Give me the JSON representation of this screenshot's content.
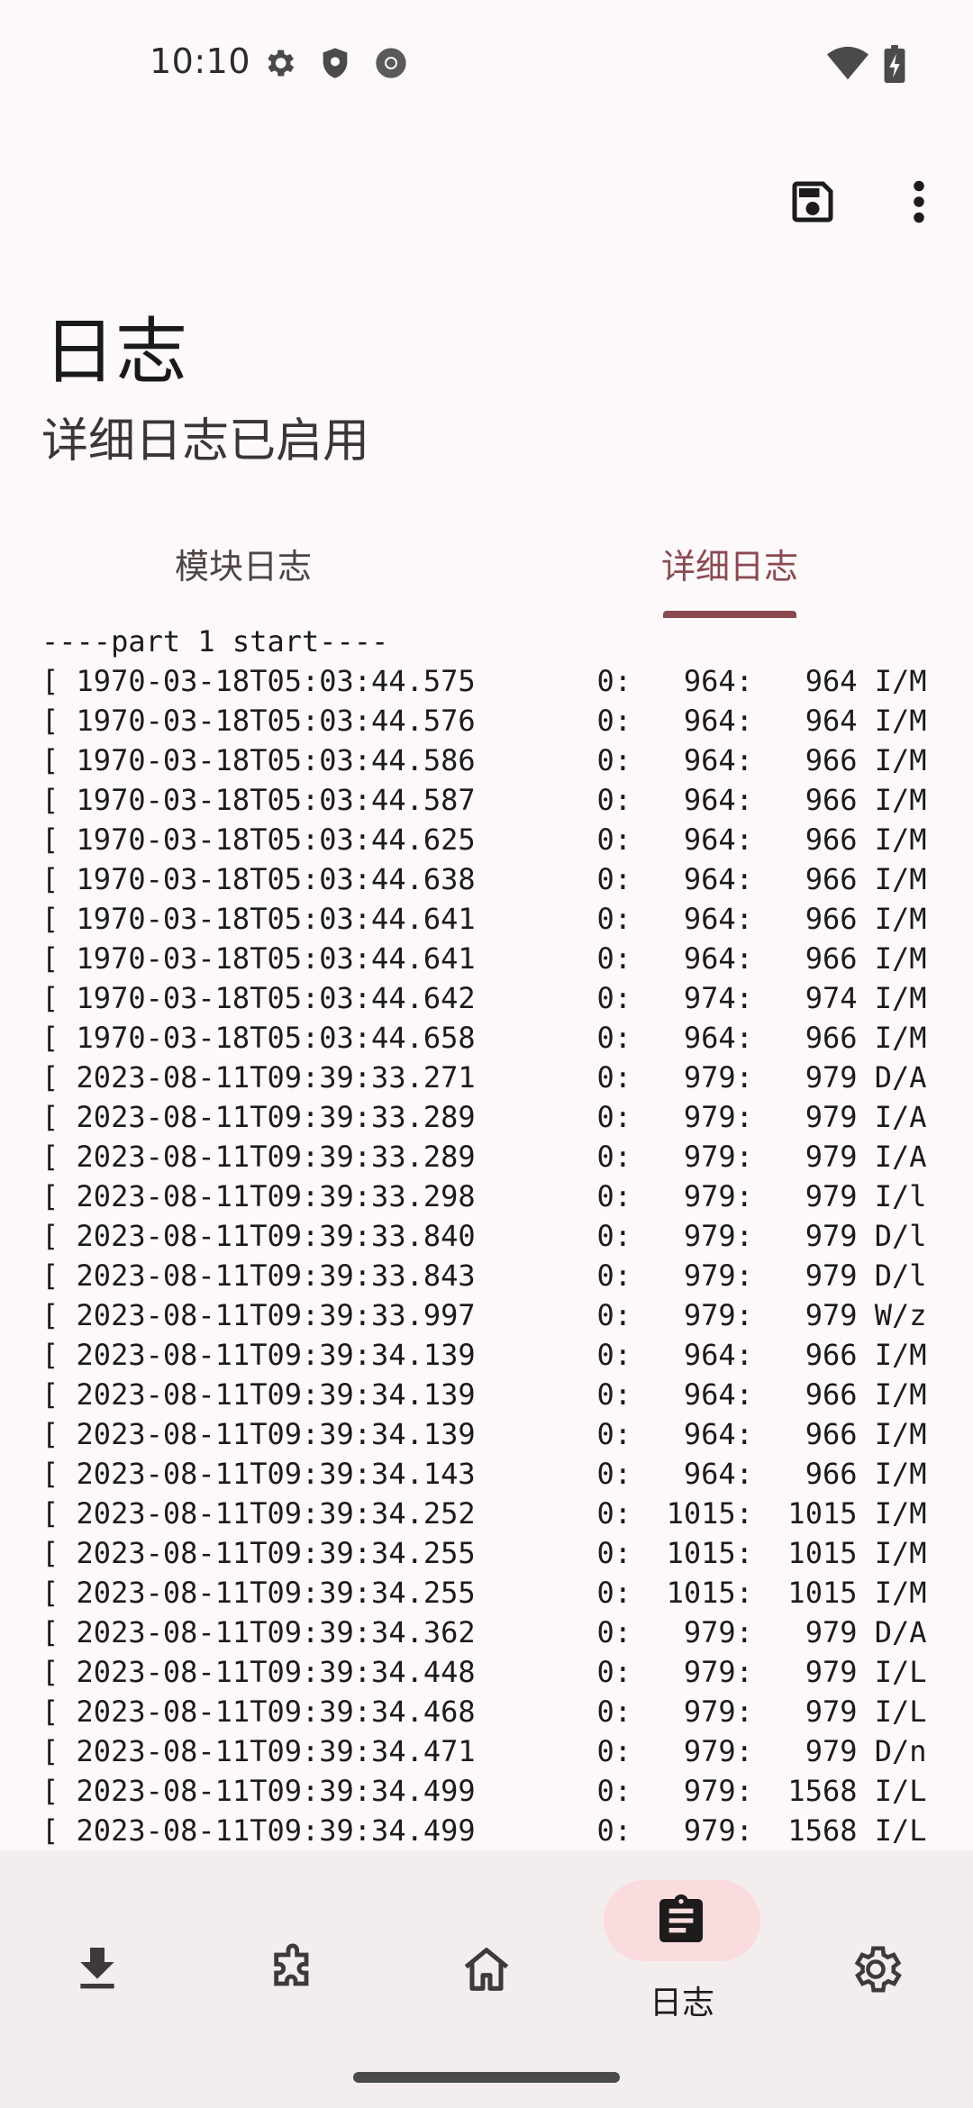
{
  "status_bar": {
    "time": "10:10",
    "left_icons": [
      "gear-icon",
      "shield-icon",
      "chrome-icon"
    ],
    "right_icons": [
      "wifi-icon",
      "battery-charging-icon"
    ]
  },
  "toolbar": {
    "actions": [
      "save-icon",
      "more-vert-icon"
    ]
  },
  "header": {
    "title": "日志",
    "subtitle": "详细日志已启用"
  },
  "tabs": [
    {
      "label": "模块日志",
      "active": false
    },
    {
      "label": "详细日志",
      "active": true
    }
  ],
  "log": {
    "lines": [
      "----part 1 start----",
      "[ 1970-03-18T05:03:44.575       0:   964:   964 I/M",
      "[ 1970-03-18T05:03:44.576       0:   964:   964 I/M",
      "[ 1970-03-18T05:03:44.586       0:   964:   966 I/M",
      "[ 1970-03-18T05:03:44.587       0:   964:   966 I/M",
      "[ 1970-03-18T05:03:44.625       0:   964:   966 I/M",
      "[ 1970-03-18T05:03:44.638       0:   964:   966 I/M",
      "[ 1970-03-18T05:03:44.641       0:   964:   966 I/M",
      "[ 1970-03-18T05:03:44.641       0:   964:   966 I/M",
      "[ 1970-03-18T05:03:44.642       0:   974:   974 I/M",
      "[ 1970-03-18T05:03:44.658       0:   964:   966 I/M",
      "[ 2023-08-11T09:39:33.271       0:   979:   979 D/A",
      "[ 2023-08-11T09:39:33.289       0:   979:   979 I/A",
      "[ 2023-08-11T09:39:33.289       0:   979:   979 I/A",
      "[ 2023-08-11T09:39:33.298       0:   979:   979 I/l",
      "[ 2023-08-11T09:39:33.840       0:   979:   979 D/l",
      "[ 2023-08-11T09:39:33.843       0:   979:   979 D/l",
      "[ 2023-08-11T09:39:33.997       0:   979:   979 W/z",
      "[ 2023-08-11T09:39:34.139       0:   964:   966 I/M",
      "[ 2023-08-11T09:39:34.139       0:   964:   966 I/M",
      "[ 2023-08-11T09:39:34.139       0:   964:   966 I/M",
      "[ 2023-08-11T09:39:34.143       0:   964:   966 I/M",
      "[ 2023-08-11T09:39:34.252       0:  1015:  1015 I/M",
      "[ 2023-08-11T09:39:34.255       0:  1015:  1015 I/M",
      "[ 2023-08-11T09:39:34.255       0:  1015:  1015 I/M",
      "[ 2023-08-11T09:39:34.362       0:   979:   979 D/A",
      "[ 2023-08-11T09:39:34.448       0:   979:   979 I/L",
      "[ 2023-08-11T09:39:34.468       0:   979:   979 I/L",
      "[ 2023-08-11T09:39:34.471       0:   979:   979 D/n",
      "[ 2023-08-11T09:39:34.499       0:   979:  1568 I/L",
      "[ 2023-08-11T09:39:34.499       0:   979:  1568 I/L"
    ]
  },
  "bottom_nav": {
    "items": [
      {
        "icon": "download-icon",
        "label": "",
        "active": false
      },
      {
        "icon": "puzzle-icon",
        "label": "",
        "active": false
      },
      {
        "icon": "home-icon",
        "label": "",
        "active": false
      },
      {
        "icon": "clipboard-list-icon",
        "label": "日志",
        "active": true
      },
      {
        "icon": "settings-icon",
        "label": "",
        "active": false
      }
    ]
  },
  "colors": {
    "accent": "#8a4a50",
    "active_pill": "#fadcde",
    "nav_background": "#f3edee",
    "background": "#fdf8f9"
  }
}
